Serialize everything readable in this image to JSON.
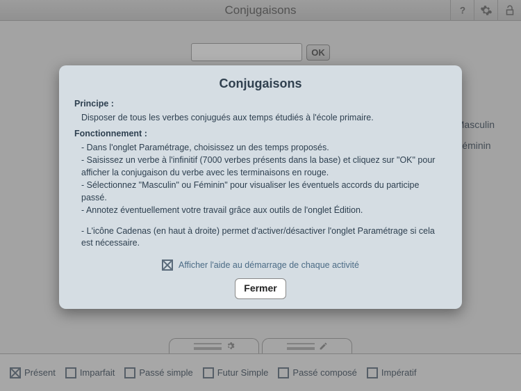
{
  "header": {
    "title": "Conjugaisons"
  },
  "search": {
    "ok_label": "OK"
  },
  "gender": {
    "masculin": "Masculin",
    "feminin": "Féminin"
  },
  "tenses": {
    "present": "Présent",
    "imparfait": "Imparfait",
    "passe_simple": "Passé simple",
    "futur_simple": "Futur Simple",
    "passe_compose": "Passé composé",
    "imperatif": "Impératif"
  },
  "dialog": {
    "title": "Conjugaisons",
    "principe_label": "Principe :",
    "principe_text": "Disposer de tous les verbes conjugués aux temps étudiés à l'école primaire.",
    "fonction_label": "Fonctionnement :",
    "f1": "- Dans l'onglet Paramétrage, choisissez un des temps proposés.",
    "f2": "- Saisissez un verbe à l'infinitif (7000 verbes présents dans la base) et cliquez sur \"OK\" pour afficher la conjugaison du verbe avec les terminaisons en rouge.",
    "f3": "- Sélectionnez \"Masculin\" ou Féminin\" pour visualiser les éventuels accords du participe passé.",
    "f4": "- Annotez éventuellement votre travail grâce aux outils de l'onglet Édition.",
    "f5": "- L'icône Cadenas (en haut à droite) permet d'activer/désactiver l'onglet Paramétrage si cela est nécessaire.",
    "help_checkbox_label": "Afficher l'aide au démarrage de chaque activité",
    "close_label": "Fermer"
  }
}
